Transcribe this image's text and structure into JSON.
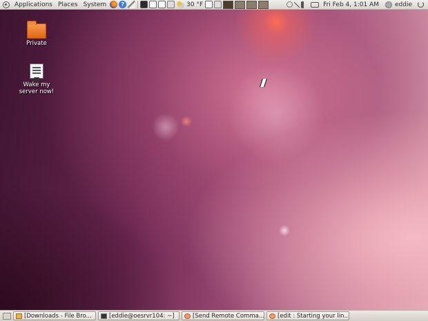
{
  "top_panel": {
    "menus": [
      "Applications",
      "Places",
      "System"
    ],
    "weather_temp": "30 °F",
    "clock": "Fri Feb  4,  1:01 AM",
    "user": "eddie",
    "workspaces": 4,
    "icons": [
      "ubuntu-logo-icon",
      "firefox-icon",
      "help-icon",
      "text-editor-icon",
      "terminal-icon",
      "window-icon",
      "network-icon",
      "weather-icon",
      "screenshot-icon",
      "trash-icon"
    ]
  },
  "desktop": {
    "icons": [
      {
        "label": "Private",
        "icon": "folder-icon"
      },
      {
        "label": "Wake my server now!",
        "icon": "script-icon"
      }
    ]
  },
  "taskbar": {
    "tasks": [
      {
        "label": "[Downloads - File Bro...",
        "icon": "file-manager-icon"
      },
      {
        "label": "[eddie@oesrvr104: ~]",
        "icon": "terminal-icon"
      },
      {
        "label": "[Send Remote Comma...",
        "icon": "remote-command-icon"
      },
      {
        "label": "[edit : Starting your lin...",
        "icon": "remote-command-icon"
      }
    ]
  }
}
